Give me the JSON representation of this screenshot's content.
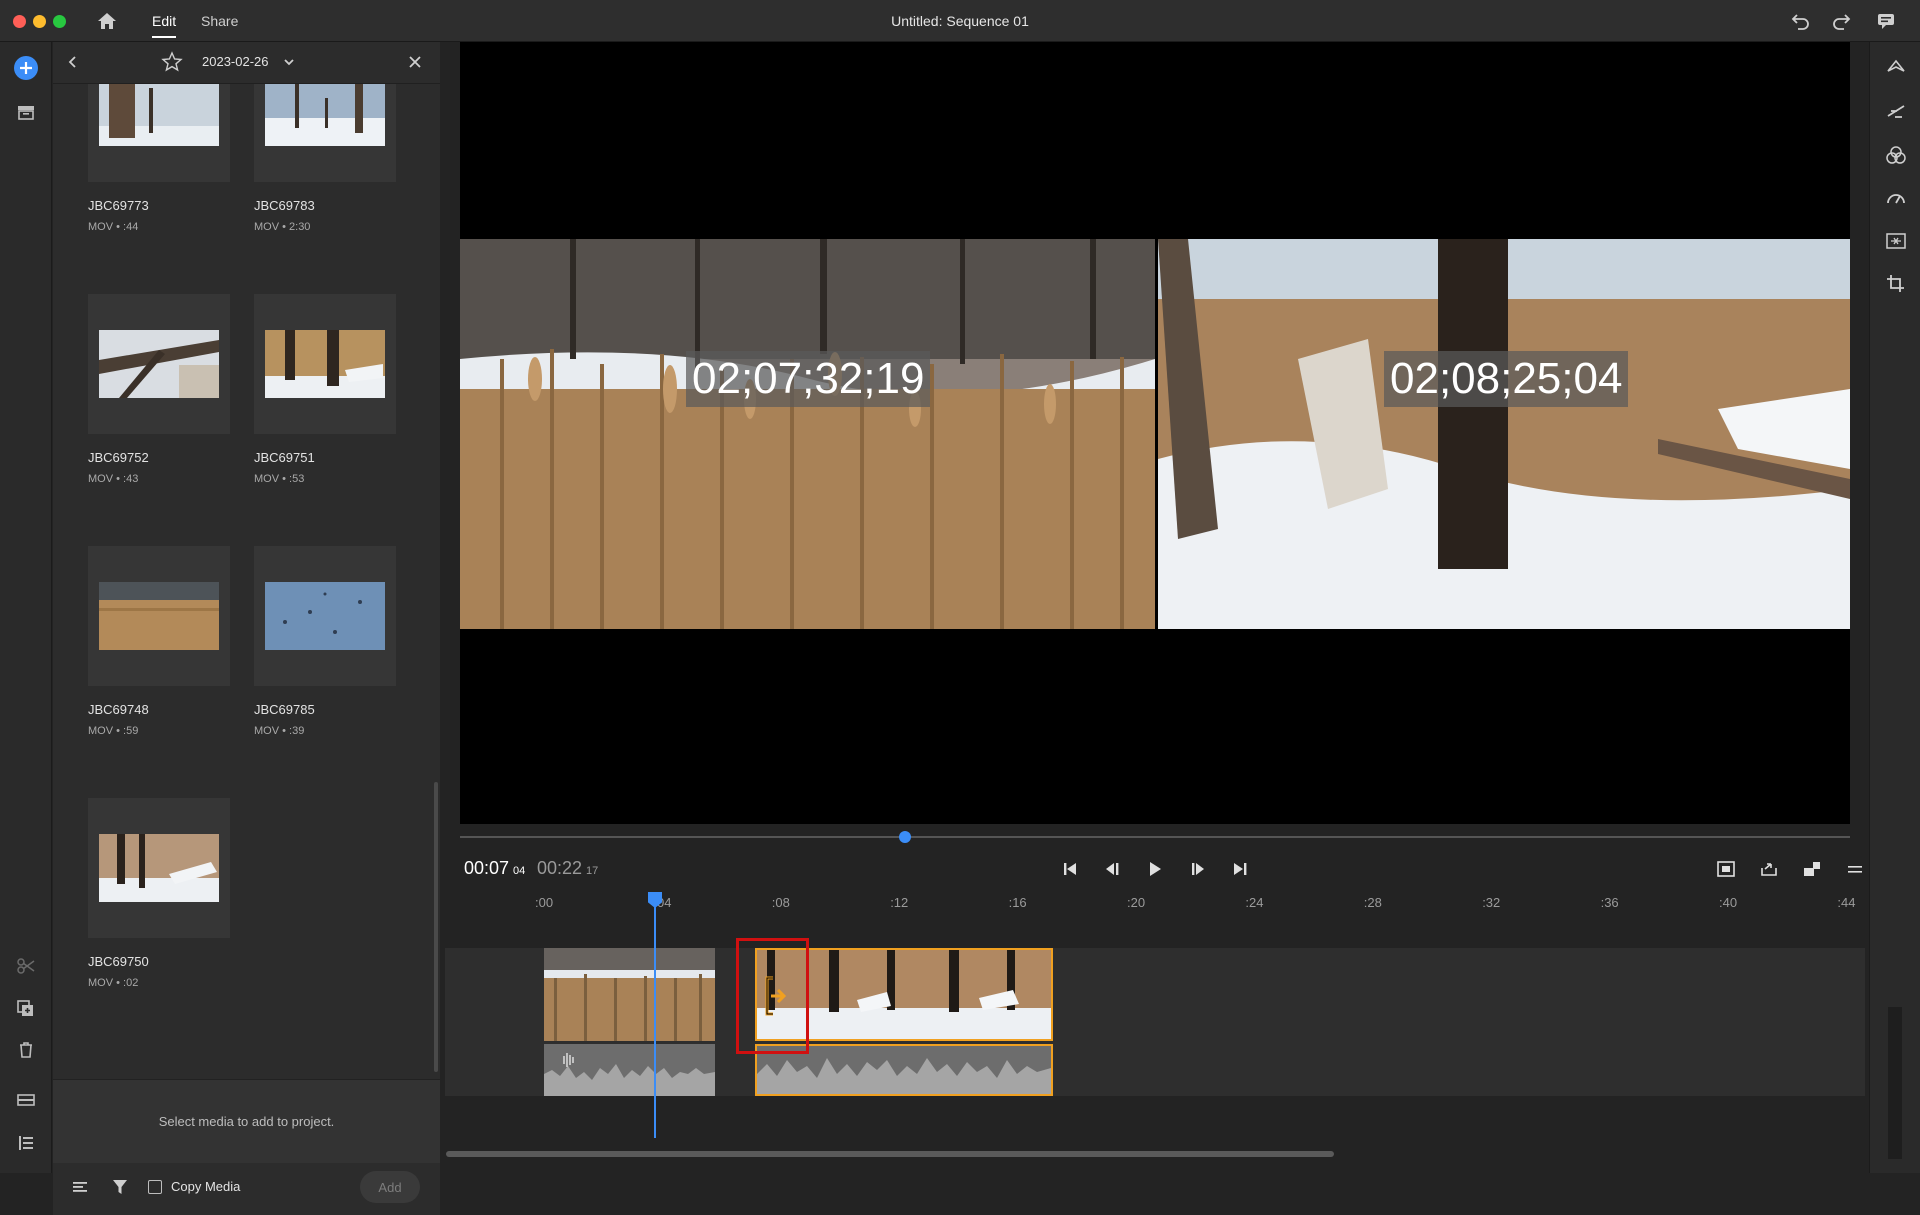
{
  "window": {
    "title": "Untitled: Sequence 01",
    "tabs": [
      "Edit",
      "Share"
    ],
    "active_tab": "Edit",
    "colors": {
      "close": "#ff5f57",
      "minimize": "#febc2e",
      "zoom": "#28c840"
    }
  },
  "media_panel": {
    "date": "2023-02-26",
    "hint": "Select media to add to project.",
    "copy_media_label": "Copy Media",
    "add_label": "Add",
    "items": [
      {
        "name": "JBC69773",
        "meta": "MOV • :44"
      },
      {
        "name": "JBC69783",
        "meta": "MOV • 2:30"
      },
      {
        "name": "JBC69752",
        "meta": "MOV • :43"
      },
      {
        "name": "JBC69751",
        "meta": "MOV • :53"
      },
      {
        "name": "JBC69748",
        "meta": "MOV • :59"
      },
      {
        "name": "JBC69785",
        "meta": "MOV • :39"
      },
      {
        "name": "JBC69750",
        "meta": "MOV • :02"
      }
    ]
  },
  "viewer": {
    "left_timecode": "02;07;32;19",
    "right_timecode": "02;08;25;04"
  },
  "transport": {
    "current_main": "00:07",
    "current_frames": "04",
    "duration_main": "00:22",
    "duration_frames": "17",
    "scrub_progress": 0.32
  },
  "ruler": {
    "ticks": [
      ":00",
      ":04",
      ":08",
      ":12",
      ":16",
      ":20",
      ":24",
      ":28",
      ":32",
      ":36",
      ":40",
      ":44"
    ]
  },
  "colors": {
    "accent": "#3b8df7",
    "clip_selected_border": "#f0a020",
    "trim_highlight": "#d01010"
  },
  "icons": {
    "home": "home-icon",
    "undo": "undo-icon",
    "redo": "redo-icon",
    "feedback": "feedback-icon"
  }
}
